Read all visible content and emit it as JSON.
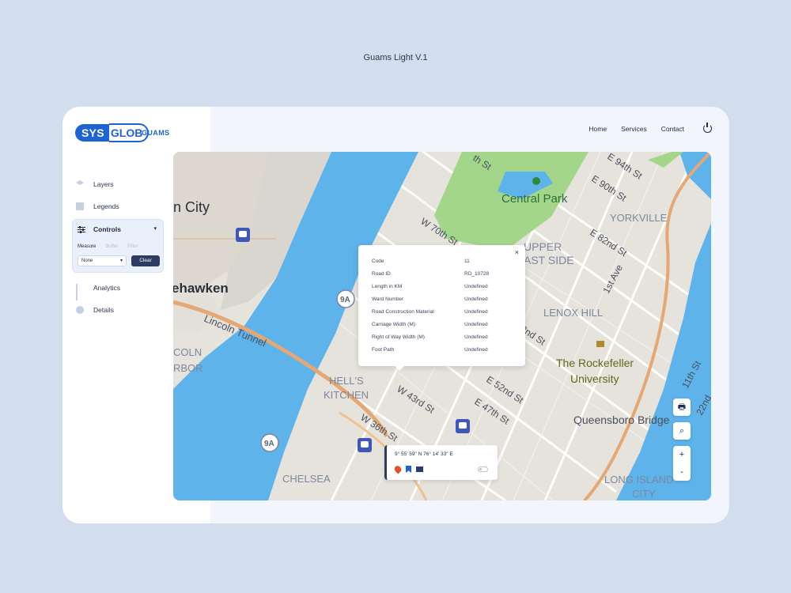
{
  "page_caption": "Guams Light V.1",
  "brand": {
    "logo_part1": "SYS",
    "logo_part2": "GLOB",
    "product": "GUAMS"
  },
  "topnav": [
    "Home",
    "Services",
    "Contact"
  ],
  "sidebar": {
    "items": [
      {
        "label": "Layers",
        "icon": "layers-icon"
      },
      {
        "label": "Legends",
        "icon": "map-icon"
      },
      {
        "label": "Controls",
        "icon": "sliders-icon"
      },
      {
        "label": "Analytics",
        "icon": "bar-chart-icon"
      },
      {
        "label": "Details",
        "icon": "info-icon"
      }
    ],
    "controls": {
      "tabs": [
        "Measure",
        "Buffer",
        "Filter"
      ],
      "select_value": "None",
      "clear_label": "Clear"
    }
  },
  "map": {
    "labels": [
      "n City",
      "ehawken",
      "Lincoln Tunnel",
      "COLN",
      "RBOR",
      "HELL'S",
      "KITCHEN",
      "W 43rd St",
      "W 36th St",
      "CHELSEA",
      "W 70th St",
      "Central Park",
      "UPPER",
      "AST SIDE",
      "YORKVILLE",
      "E 94th St",
      "E 90th St",
      "E 82nd St",
      "1st Ave",
      "LENOX HILL",
      "2nd St",
      "The Rockefeller",
      "University",
      "E 52nd St",
      "E 47th St",
      "Queensboro Bridge",
      "LONG ISLAND",
      "CITY",
      "11th St",
      "22nd",
      "th St",
      "9A",
      "9A"
    ]
  },
  "info_popup": {
    "rows": [
      {
        "key": "Code",
        "value": "11"
      },
      {
        "key": "Road ID",
        "value": "RD_10728"
      },
      {
        "key": "Length in KM",
        "value": "Undefined"
      },
      {
        "key": "Ward Number",
        "value": "Undefined"
      },
      {
        "key": "Road Construction Material",
        "value": "Undefined"
      },
      {
        "key": "Carriage Width (M)",
        "value": "Undefined"
      },
      {
        "key": "Right of Way Width (M)",
        "value": "Undefined"
      },
      {
        "key": "Foot Path",
        "value": "Undefined"
      }
    ],
    "close": "×"
  },
  "coord_card": {
    "text": "9° 55' 59\" N 76° 14' 33\" E"
  },
  "map_controls": {
    "print": "🖶",
    "search": "⌕",
    "zoom_in": "+",
    "zoom_out": "-"
  },
  "colors": {
    "accent": "#1e63d6",
    "dark": "#2c3b63",
    "water": "#5eb3ea",
    "park": "#a3d68a",
    "road": "#e5a774"
  }
}
